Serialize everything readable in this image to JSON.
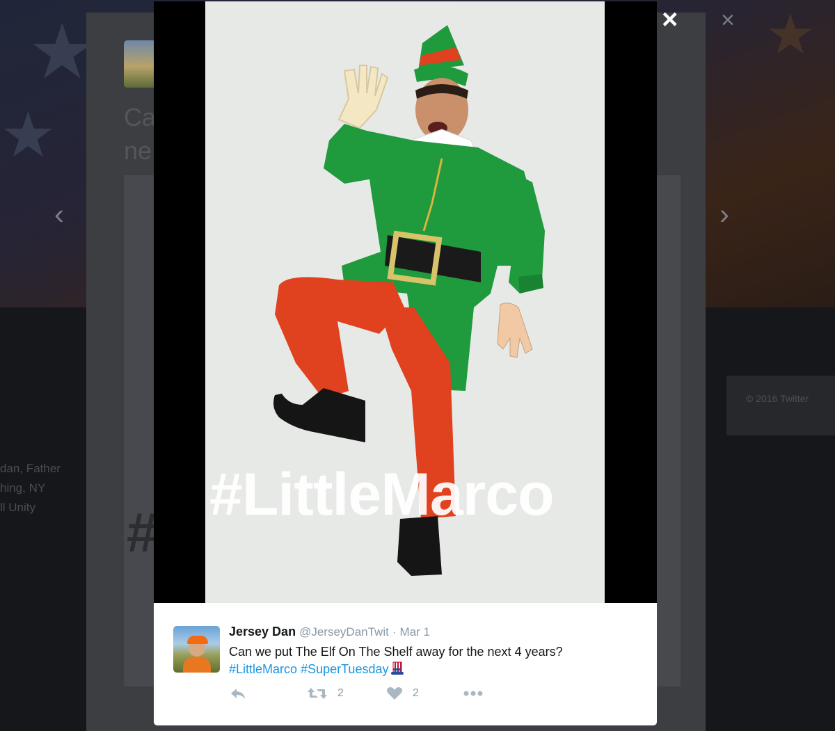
{
  "modal": {
    "close_icon": "×",
    "photo_overlay_text": "#LittleMarco"
  },
  "tweet": {
    "name": "Jersey Dan",
    "handle": "@JerseyDanTwit",
    "separator": "·",
    "date": "Mar 1",
    "text": "Can we put The Elf On The Shelf away for the next 4 years?",
    "hashtags": [
      "#LittleMarco",
      "#SuperTuesday"
    ],
    "emoji": "uncle-sam-hat-emoji",
    "actions": {
      "reply_icon": "reply-icon",
      "retweet_icon": "retweet-icon",
      "retweet_count": "2",
      "like_icon": "heart-icon",
      "like_count": "2",
      "more_icon": "more-icon"
    }
  },
  "background": {
    "title_fragment_1": "Ca",
    "title_fragment_2": "ne",
    "bio_line_1": "dan, Father",
    "bio_line_2": "hing, NY",
    "bio_line_3": "ll Unity",
    "footer_copyright": "© 2016 Twitter",
    "prev_arrow": "‹",
    "next_arrow": "›",
    "close_icon": "×"
  },
  "colors": {
    "hashtag_link": "#1b95e0",
    "elf_green": "#1f9a3c",
    "elf_red": "#e0411f"
  }
}
